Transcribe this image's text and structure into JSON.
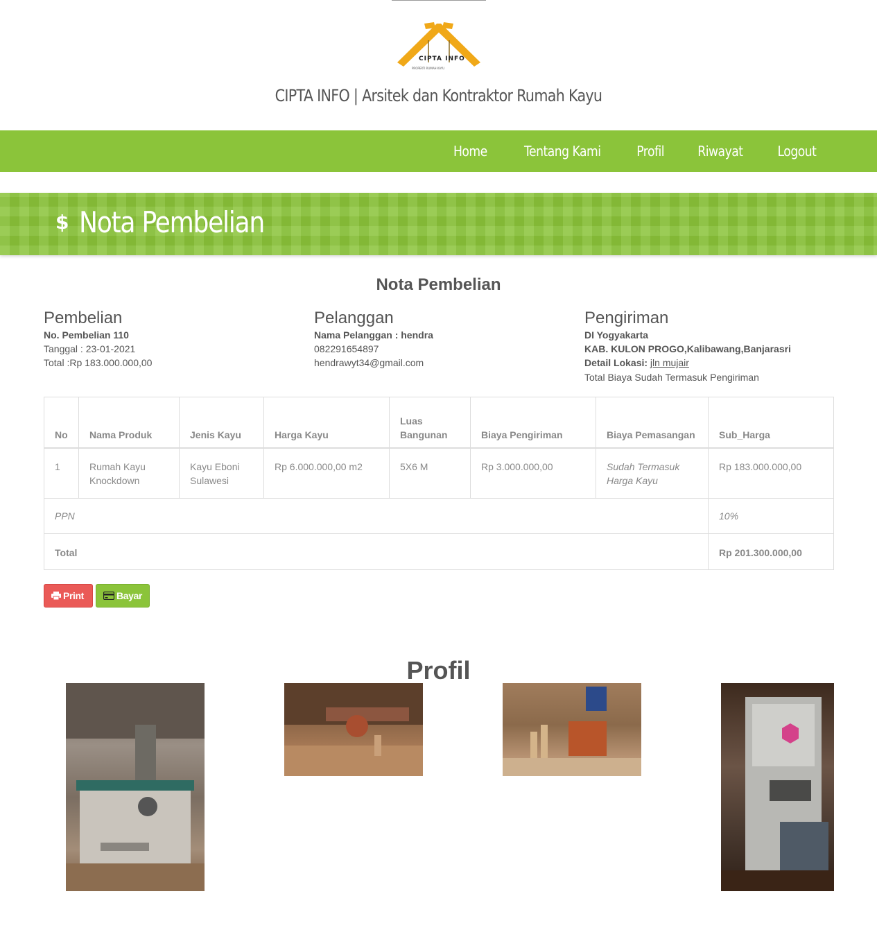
{
  "header": {
    "logo_text": "CIPTA INFO",
    "logo_tagline": "PROPERTI RUMAH KAYU",
    "site_title": "CIPTA INFO | Arsitek dan Kontraktor Rumah Kayu"
  },
  "nav": {
    "items": [
      "Home",
      "Tentang Kami",
      "Profil",
      "Riwayat",
      "Logout"
    ]
  },
  "banner": {
    "icon": "$",
    "title": "Nota Pembelian"
  },
  "nota": {
    "heading": "Nota Pembelian",
    "pembelian": {
      "heading": "Pembelian",
      "no": "No. Pembelian 110",
      "tanggal": "Tanggal : 23-01-2021",
      "total": "Total :Rp 183.000.000,00"
    },
    "pelanggan": {
      "heading": "Pelanggan",
      "nama": "Nama Pelanggan : hendra",
      "phone": "082291654897",
      "email": "hendrawyt34@gmail.com"
    },
    "pengiriman": {
      "heading": "Pengiriman",
      "provinsi": "DI Yogyakarta",
      "alamat": "KAB. KULON PROGO,Kalibawang,Banjarasri",
      "detail_label": "Detail Lokasi:",
      "detail_value": "jln mujair",
      "note": "Total Biaya Sudah Termasuk Pengiriman"
    }
  },
  "table": {
    "headers": [
      "No",
      "Nama Produk",
      "Jenis Kayu",
      "Harga Kayu",
      "Luas Bangunan",
      "Biaya Pengiriman",
      "Biaya Pemasangan",
      "Sub_Harga"
    ],
    "rows": [
      [
        "1",
        "Rumah Kayu Knockdown",
        "Kayu Eboni Sulawesi",
        "Rp 6.000.000,00 m2",
        "5X6 M",
        "Rp 3.000.000,00",
        "Sudah Termasuk Harga Kayu",
        "Rp 183.000.000,00"
      ]
    ],
    "ppn_label": "PPN",
    "ppn_value": "10%",
    "total_label": "Total",
    "total_value": "Rp 201.300.000,00"
  },
  "buttons": {
    "print": "Print",
    "bayar": "Bayar"
  },
  "profil": {
    "heading": "Profil"
  },
  "colors": {
    "brand_green": "#8bc43a",
    "print_red": "#ea5a57",
    "logo_orange": "#f0a818"
  },
  "icons": [
    "dollar-icon",
    "printer-icon",
    "credit-card-icon"
  ]
}
